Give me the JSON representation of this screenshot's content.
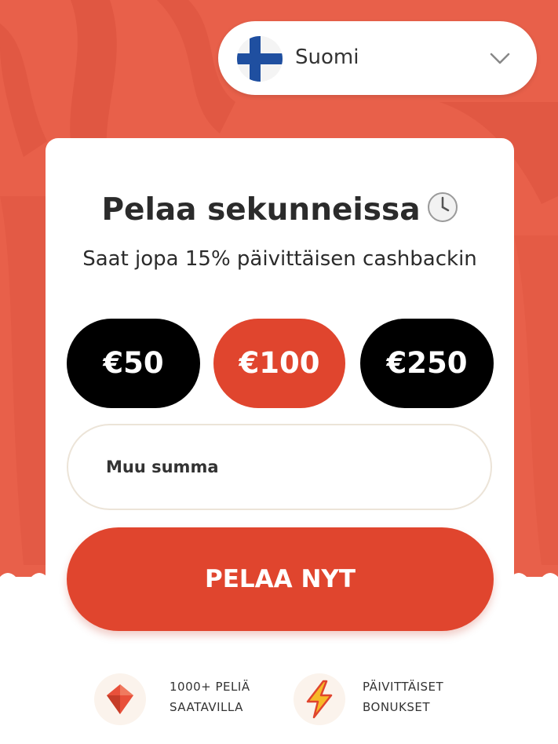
{
  "language_selector": {
    "label": "Suomi",
    "flag_icon": "finland-flag-icon",
    "chevron_icon": "chevron-down-icon"
  },
  "card": {
    "title": "Pelaa sekunneissa",
    "title_icon": "clock-icon",
    "subtitle": "Saat jopa 15% päivittäisen cashbackin",
    "amounts": [
      {
        "label": "€50",
        "selected": false
      },
      {
        "label": "€100",
        "selected": true
      },
      {
        "label": "€250",
        "selected": false
      }
    ],
    "other_amount_placeholder": "Muu summa",
    "play_button": "PELAA NYT"
  },
  "features": [
    {
      "icon": "gem-icon",
      "line1": "1000+ PELIÄ",
      "line2": "SAATAVILLA"
    },
    {
      "icon": "lightning-icon",
      "line1": "PÄIVITTÄISET",
      "line2": "BONUKSET"
    }
  ],
  "colors": {
    "background": "#e8604a",
    "accent": "#e0452e",
    "dark_button": "#000000",
    "card": "#ffffff"
  }
}
